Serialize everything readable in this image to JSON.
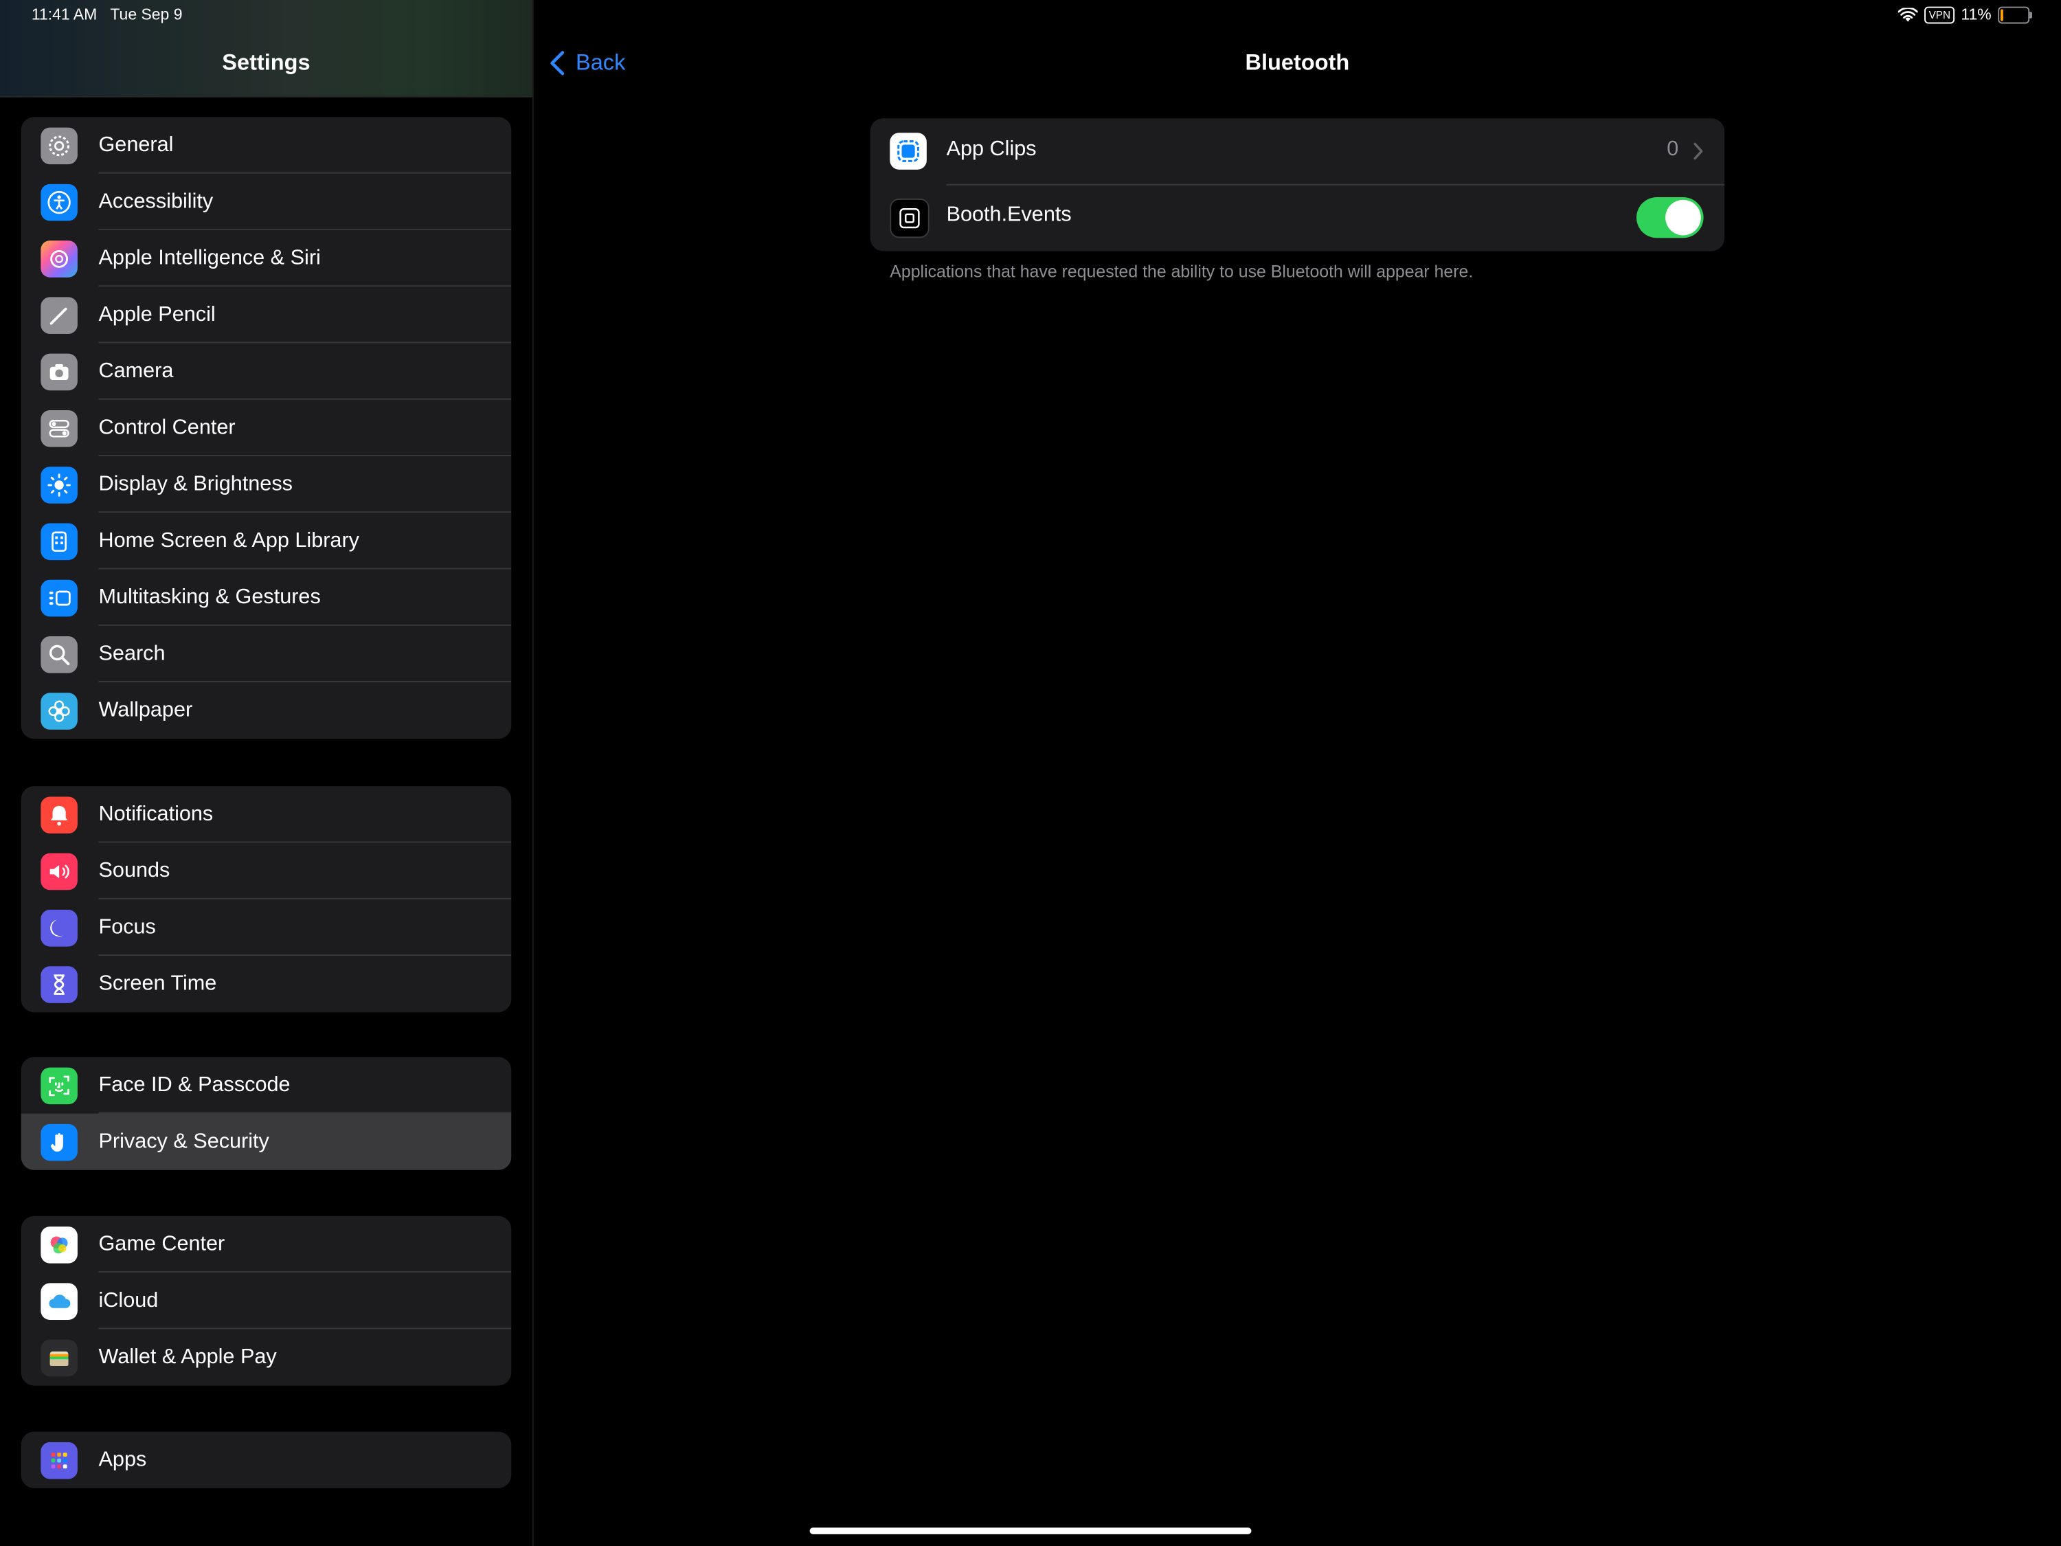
{
  "status_bar": {
    "time": "11:41 AM",
    "date": "Tue Sep 9",
    "vpn": "VPN",
    "battery": "11%",
    "battery_level": 0.11
  },
  "sidebar": {
    "title": "Settings",
    "groups": [
      {
        "items": [
          {
            "label": "General",
            "icon": "gear-icon",
            "color": "#8e8e93"
          },
          {
            "label": "Accessibility",
            "icon": "accessibility-icon",
            "color": "#0a84ff"
          },
          {
            "label": "Apple Intelligence & Siri",
            "icon": "apple-intelligence-icon",
            "color": "#ff5fa2"
          },
          {
            "label": "Apple Pencil",
            "icon": "pencil-icon",
            "color": "#8e8e93"
          },
          {
            "label": "Camera",
            "icon": "camera-icon",
            "color": "#8e8e93"
          },
          {
            "label": "Control Center",
            "icon": "control-center-icon",
            "color": "#8e8e93"
          },
          {
            "label": "Display & Brightness",
            "icon": "sun-icon",
            "color": "#0a84ff"
          },
          {
            "label": "Home Screen & App Library",
            "icon": "home-screen-icon",
            "color": "#0a84ff"
          },
          {
            "label": "Multitasking & Gestures",
            "icon": "multitasking-icon",
            "color": "#0a84ff"
          },
          {
            "label": "Search",
            "icon": "search-icon",
            "color": "#8e8e93"
          },
          {
            "label": "Wallpaper",
            "icon": "wallpaper-flower-icon",
            "color": "#32ade6"
          }
        ]
      },
      {
        "items": [
          {
            "label": "Notifications",
            "icon": "bell-icon",
            "color": "#ff453a"
          },
          {
            "label": "Sounds",
            "icon": "speaker-icon",
            "color": "#ff375f"
          },
          {
            "label": "Focus",
            "icon": "moon-icon",
            "color": "#5e5ce6"
          },
          {
            "label": "Screen Time",
            "icon": "hourglass-icon",
            "color": "#5e5ce6"
          }
        ]
      },
      {
        "items": [
          {
            "label": "Face ID & Passcode",
            "icon": "face-id-icon",
            "color": "#30d158"
          },
          {
            "label": "Privacy & Security",
            "icon": "hand-icon",
            "color": "#0a84ff",
            "selected": true
          }
        ]
      },
      {
        "items": [
          {
            "label": "Game Center",
            "icon": "game-center-icon",
            "color": "#ffffff"
          },
          {
            "label": "iCloud",
            "icon": "cloud-icon",
            "color": "#ffffff"
          },
          {
            "label": "Wallet & Apple Pay",
            "icon": "wallet-icon",
            "color": "#2c2c2e"
          }
        ]
      },
      {
        "items": [
          {
            "label": "Apps",
            "icon": "apps-grid-icon",
            "color": "#5e5ce6"
          }
        ]
      }
    ]
  },
  "nav": {
    "back_label": "Back",
    "title": "Bluetooth"
  },
  "bluetooth": {
    "rows": [
      {
        "label": "App Clips",
        "value": "0"
      },
      {
        "label": "Booth.Events",
        "toggle_on": true
      }
    ],
    "footnote": "Applications that have requested the ability to use Bluetooth will appear here."
  }
}
